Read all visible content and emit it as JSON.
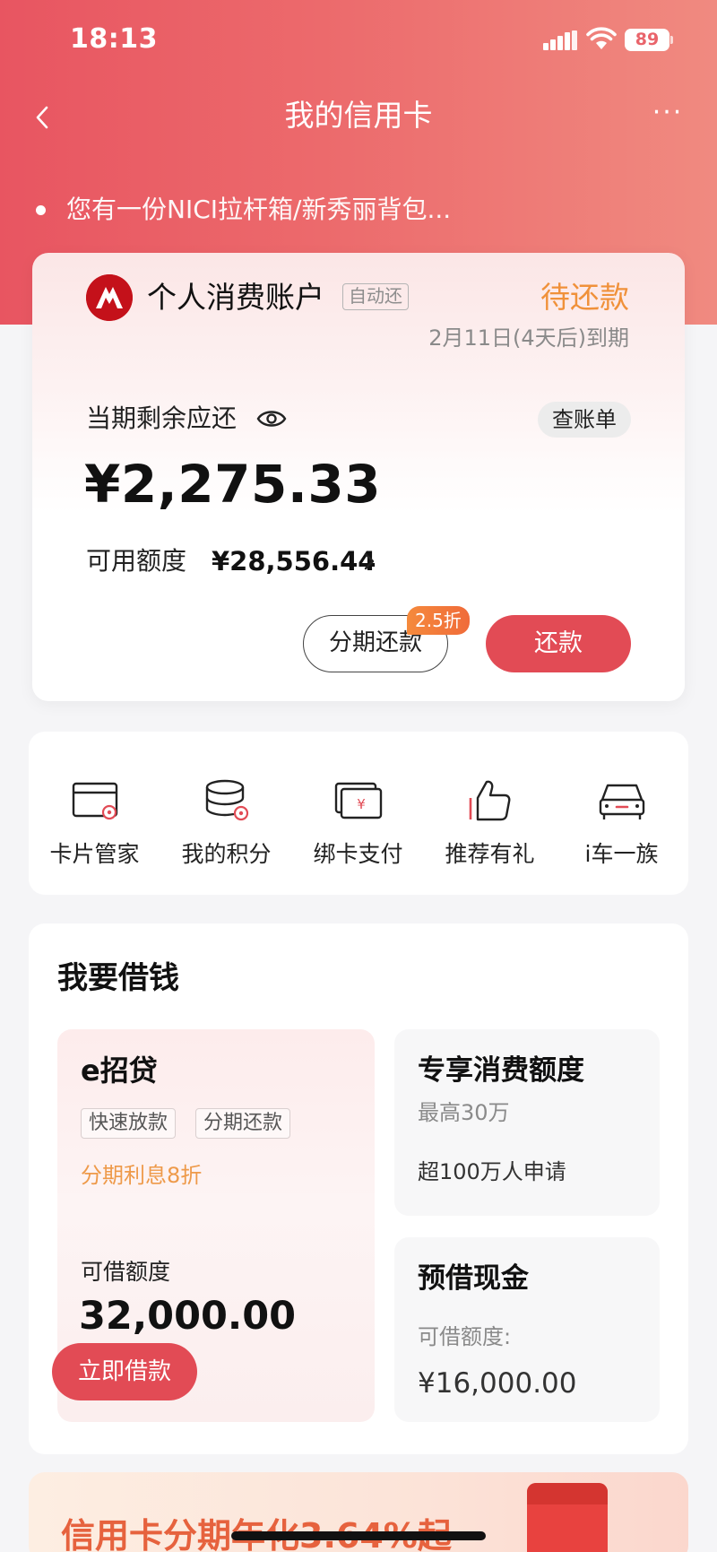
{
  "status_bar": {
    "time": "18:13",
    "battery": "89"
  },
  "nav": {
    "title": "我的信用卡",
    "more": "···"
  },
  "notice": {
    "text": "您有一份NICI拉杆箱/新秀丽背包..."
  },
  "account": {
    "name": "个人消费账户",
    "tag": "自动还",
    "status": "待还款",
    "due": "2月11日(4天后)到期",
    "balance_label": "当期剩余应还",
    "bill_button": "查账单",
    "balance": "¥2,275.33",
    "credit_label": "可用额度",
    "credit_amount": "¥28,556.44",
    "installment_button": "分期还款",
    "installment_badge": "2.5折",
    "repay_button": "还款"
  },
  "quick_actions": [
    {
      "label": "卡片管家",
      "icon": "card-manage-icon"
    },
    {
      "label": "我的积分",
      "icon": "points-icon"
    },
    {
      "label": "绑卡支付",
      "icon": "bind-card-pay-icon"
    },
    {
      "label": "推荐有礼",
      "icon": "thumbs-up-icon"
    },
    {
      "label": "i车一族",
      "icon": "car-icon"
    }
  ],
  "loan": {
    "title": "我要借钱",
    "eloan": {
      "name": "e招贷",
      "tags": [
        "快速放款",
        "分期还款"
      ],
      "promo": "分期利息8折",
      "limit_label": "可借额度",
      "limit": "32,000.00",
      "button": "立即借款"
    },
    "consumer": {
      "title": "专享消费额度",
      "sub": "最高30万",
      "note": "超100万人申请"
    },
    "cash": {
      "title": "预借现金",
      "label": "可借额度:",
      "amount": "¥16,000.00"
    }
  },
  "promo_banner": {
    "text": "信用卡分期年化3.64%起"
  },
  "colors": {
    "primary": "#e24b55",
    "accent_orange": "#f0913a",
    "header_gradient_start": "#e85561",
    "header_gradient_end": "#f08a80"
  }
}
